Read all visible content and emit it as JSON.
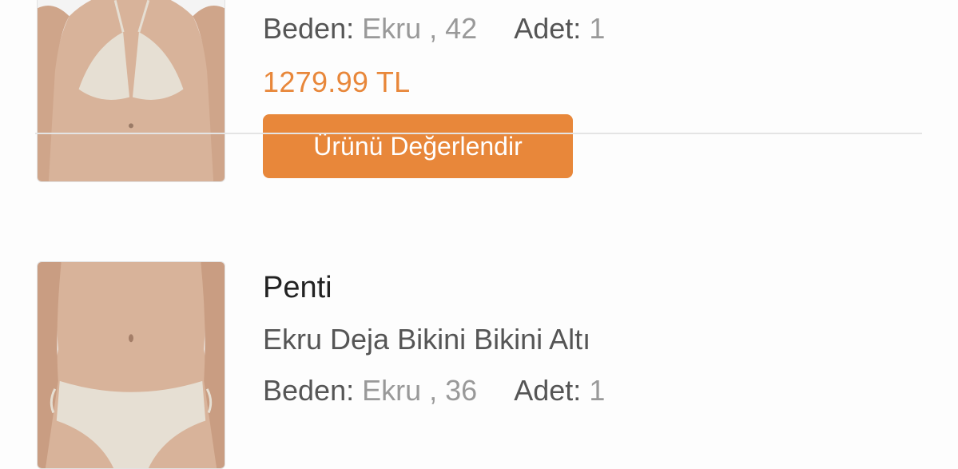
{
  "items": [
    {
      "brand": "",
      "title": "",
      "size_label": "Beden:",
      "size_value": "Ekru , 42",
      "qty_label": "Adet:",
      "qty_value": "1",
      "price": "1279.99 TL",
      "review_button": "Ürünü Değerlendir",
      "image_icon": "bikini-top-product-photo"
    },
    {
      "brand": "Penti",
      "title": "Ekru Deja Bikini Bikini Altı",
      "size_label": "Beden:",
      "size_value": "Ekru , 36",
      "qty_label": "Adet:",
      "qty_value": "1",
      "image_icon": "bikini-bottom-product-photo"
    }
  ],
  "colors": {
    "accent": "#e8873a",
    "divider": "#e4e4e4"
  }
}
